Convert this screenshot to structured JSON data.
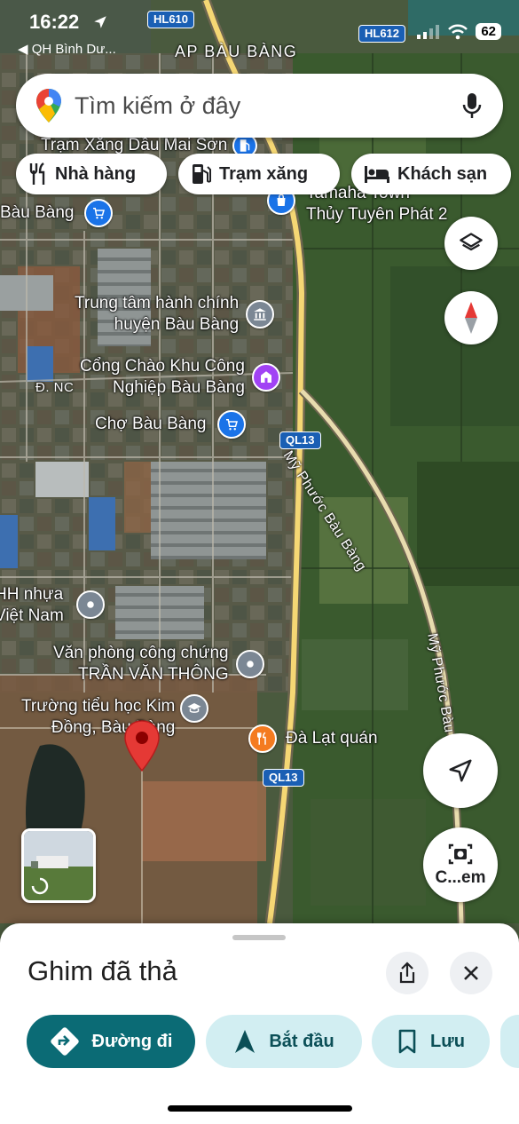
{
  "status_bar": {
    "time": "16:22",
    "back_label": "◀ QH Bình Dư...",
    "battery": "62"
  },
  "search": {
    "placeholder": "Tìm kiếm ở đây"
  },
  "chips": [
    {
      "label": "Nhà hàng",
      "icon": "restaurant-icon"
    },
    {
      "label": "Trạm xăng",
      "icon": "gas-station-icon"
    },
    {
      "label": "Khách sạn",
      "icon": "hotel-icon"
    }
  ],
  "map": {
    "area_label": "AP BÀU BÀNG",
    "road_shields": [
      "HL610",
      "HL612",
      "QL13",
      "QL13"
    ],
    "road_names": [
      "Mỹ Phước Bàu Bàng",
      "Mỹ Phước Bàu",
      "Đ. NC"
    ],
    "places": [
      {
        "name": "Trạm Xăng Dầu Mai Sơn",
        "icon": "gas-station-icon",
        "color": "#1a73e8"
      },
      {
        "name": "Bàu Bàng",
        "icon": "shopping-icon",
        "color": "#1a73e8"
      },
      {
        "name": "Tamaha Town\nThủy Tuyên Phát 2",
        "icon": "shopping-bag-icon",
        "color": "#1a73e8"
      },
      {
        "name": "Trung tâm hành chính\nhuyện Bàu Bàng",
        "icon": "government-icon",
        "color": "#7b8794"
      },
      {
        "name": "Cổng Chào Khu Công\nNghiệp Bàu Bàng",
        "icon": "landmark-icon",
        "color": "#a142f4"
      },
      {
        "name": "Chợ Bàu Bàng",
        "icon": "shopping-icon",
        "color": "#1a73e8"
      },
      {
        "name": "HH nhựa\nViệt Nam",
        "icon": "place-icon",
        "color": "#7b8794"
      },
      {
        "name": "Văn phòng công chứng\nTRẦN VĂN THÔNG",
        "icon": "place-icon",
        "color": "#7b8794"
      },
      {
        "name": "Trường tiểu học Kim\nĐồng, Bàu Bàng",
        "icon": "school-icon",
        "color": "#7b8794"
      },
      {
        "name": "Đà Lạt quán",
        "icon": "restaurant-icon",
        "color": "#f47b20"
      }
    ],
    "dropped_pin_color": "#e53935"
  },
  "fabs": {
    "layers": "layers-icon",
    "compass": "compass-icon",
    "navigate": "navigation-arrow-icon",
    "lens_label": "C...em"
  },
  "sheet": {
    "title": "Ghim đã thả",
    "actions": [
      {
        "label": "Đường đi",
        "icon": "directions-icon"
      },
      {
        "label": "Bắt đầu",
        "icon": "navigation-arrow-icon"
      },
      {
        "label": "Lưu",
        "icon": "bookmark-icon"
      }
    ]
  },
  "colors": {
    "primary": "#0b6b75",
    "tonal": "#d2eef2",
    "tonal_text": "#0b4f57"
  }
}
